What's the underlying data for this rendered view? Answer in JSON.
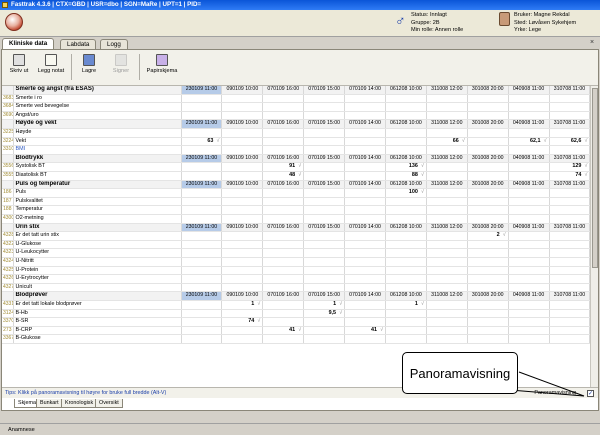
{
  "window": {
    "title": "Fasttrak 4.3.6 | CTX=GBD | USR=dbo | SGN=MaRe | UPT=1 | PID="
  },
  "patient": {
    "status": "Status: Innlagt",
    "group": "Gruppe: 2B",
    "role": "Min rolle: Annen rolle"
  },
  "user": {
    "name": "Bruker: Magne Rekdal",
    "place": "Sted: Løvåsen Sykehjem",
    "profession": "Yrke: Lege"
  },
  "tabs": [
    "Kliniske data",
    "Labdata",
    "Logg"
  ],
  "toolbar": [
    {
      "label": "Skriv ut",
      "disabled": false
    },
    {
      "label": "Legg notat",
      "disabled": false
    },
    {
      "label": "Lagre",
      "disabled": false
    },
    {
      "label": "Signer",
      "disabled": true
    },
    {
      "label": "Papirskjema",
      "disabled": false
    }
  ],
  "dates": [
    "230109 11:00",
    "090109 10:00",
    "070109 16:00",
    "070109 15:00",
    "070109 14:00",
    "061208 10:00",
    "311008 12:00",
    "301008 20:00",
    "040908 11:00",
    "310708 11:00"
  ],
  "groups": [
    {
      "title": "Smerte og angst (fra ESAS)",
      "rows": [
        {
          "id": "3683",
          "label": "Smerte i ro",
          "values": [
            "",
            "",
            "",
            "",
            "",
            "",
            "",
            "",
            "",
            ""
          ]
        },
        {
          "id": "3684",
          "label": "Smerte ved bevegelse",
          "values": [
            "",
            "",
            "",
            "",
            "",
            "",
            "",
            "",
            "",
            ""
          ]
        },
        {
          "id": "3690",
          "label": "Angst/uro",
          "values": [
            "",
            "",
            "",
            "",
            "",
            "",
            "",
            "",
            "",
            ""
          ]
        }
      ]
    },
    {
      "title": "Høyde og vekt",
      "rows": [
        {
          "id": "3225",
          "label": "Høyde",
          "values": [
            "",
            "",
            "",
            "",
            "",
            "",
            "",
            "",
            "",
            ""
          ]
        },
        {
          "id": "3224",
          "label": "Vekt",
          "values": [
            "63",
            "",
            "",
            "",
            "",
            "",
            "66",
            "",
            "62,1",
            "62,6"
          ]
        },
        {
          "id": "3310",
          "label": "BMI",
          "values": [
            "",
            "",
            "",
            "",
            "",
            "",
            "",
            "",
            "",
            ""
          ]
        }
      ]
    },
    {
      "title": "Blodtrykk",
      "rows": [
        {
          "id": "3556",
          "label": "Systolisk BT",
          "values": [
            "",
            "",
            "91",
            "",
            "",
            "136",
            "",
            "",
            "",
            "129"
          ]
        },
        {
          "id": "3555",
          "label": "Diastolisk BT",
          "values": [
            "",
            "",
            "48",
            "",
            "",
            "88",
            "",
            "",
            "",
            "74"
          ]
        }
      ]
    },
    {
      "title": "Puls og temperatur",
      "rows": [
        {
          "id": "186",
          "label": "Puls",
          "values": [
            "",
            "",
            "",
            "",
            "",
            "100",
            "",
            "",
            "",
            ""
          ]
        },
        {
          "id": "187",
          "label": "Pulskvalitet",
          "values": [
            "",
            "",
            "",
            "",
            "",
            "",
            "",
            "",
            "",
            ""
          ]
        },
        {
          "id": "188",
          "label": "Temperatur",
          "values": [
            "",
            "",
            "",
            "",
            "",
            "",
            "",
            "",
            "",
            ""
          ]
        },
        {
          "id": "4300",
          "label": "O2-metning",
          "values": [
            "",
            "",
            "",
            "",
            "",
            "",
            "",
            "",
            "",
            ""
          ]
        }
      ]
    },
    {
      "title": "Urin stix",
      "rows": [
        {
          "id": "4328",
          "label": "Er det tatt urin stix",
          "values": [
            "",
            "",
            "",
            "",
            "",
            "",
            "",
            "2",
            "",
            ""
          ]
        },
        {
          "id": "4322",
          "label": "U-Glukose",
          "values": [
            "",
            "",
            "",
            "",
            "",
            "",
            "",
            "",
            "",
            ""
          ]
        },
        {
          "id": "4323",
          "label": "U-Leukocytter",
          "values": [
            "",
            "",
            "",
            "",
            "",
            "",
            "",
            "",
            "",
            ""
          ]
        },
        {
          "id": "4324",
          "label": "U-Nitritt",
          "values": [
            "",
            "",
            "",
            "",
            "",
            "",
            "",
            "",
            "",
            ""
          ]
        },
        {
          "id": "4325",
          "label": "U-Protein",
          "values": [
            "",
            "",
            "",
            "",
            "",
            "",
            "",
            "",
            "",
            ""
          ]
        },
        {
          "id": "4326",
          "label": "U-Erytrocytter",
          "values": [
            "",
            "",
            "",
            "",
            "",
            "",
            "",
            "",
            "",
            ""
          ]
        },
        {
          "id": "4327",
          "label": "Unicult",
          "values": [
            "",
            "",
            "",
            "",
            "",
            "",
            "",
            "",
            "",
            ""
          ]
        }
      ]
    },
    {
      "title": "Blodprøver",
      "rows": [
        {
          "id": "4331",
          "label": "Er det tatt lokale blodprøver",
          "values": [
            "",
            "1",
            "",
            "1",
            "",
            "1",
            "",
            "",
            "",
            ""
          ]
        },
        {
          "id": "3124",
          "label": "B-Hb",
          "values": [
            "",
            "",
            "",
            "9,5",
            "",
            "",
            "",
            "",
            "",
            ""
          ]
        },
        {
          "id": "3370",
          "label": "B-SR",
          "values": [
            "",
            "74",
            "",
            "",
            "",
            "",
            "",
            "",
            "",
            ""
          ]
        },
        {
          "id": "273",
          "label": "B-CRP",
          "values": [
            "",
            "",
            "41",
            "",
            "41",
            "",
            "",
            "",
            "",
            ""
          ]
        },
        {
          "id": "3367",
          "label": "B-Glukose",
          "values": [
            "",
            "",
            "",
            "",
            "",
            "",
            "",
            "",
            "",
            ""
          ]
        }
      ]
    }
  ],
  "tip": "Tips: Klikk på panoramavisning til høyre for bruke full bredde (Alt-V)",
  "panorama_label": "Panoramavisning",
  "subtabs": [
    "Skjema",
    "Bunkart",
    "Kronologisk",
    "Oversikt"
  ],
  "status_text": "Anamnese",
  "callout_text": "Panoramavisning",
  "check_mark": "√",
  "close_glyph": "×",
  "pano_checked": "✓"
}
